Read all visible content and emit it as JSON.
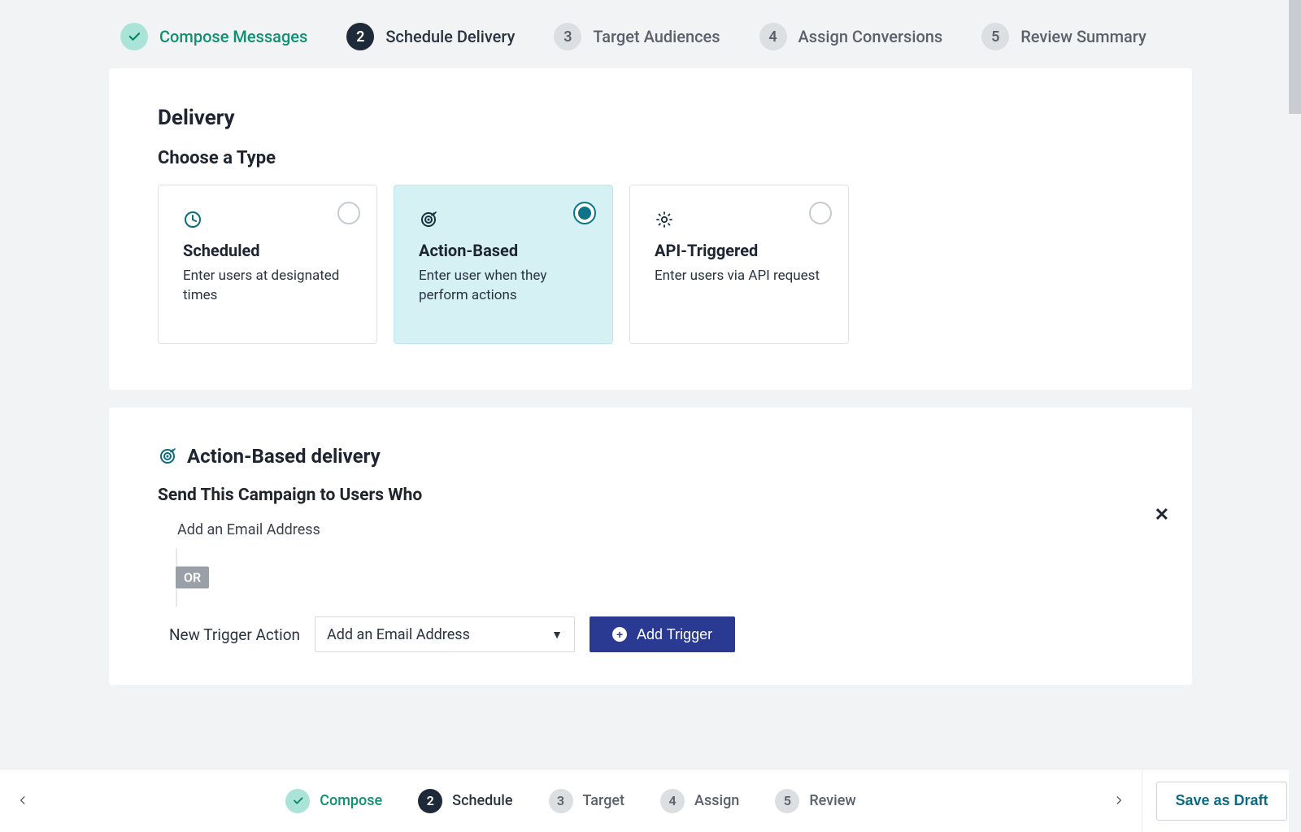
{
  "stepper": [
    {
      "state": "done",
      "label": "Compose Messages",
      "num": ""
    },
    {
      "state": "active",
      "label": "Schedule Delivery",
      "num": "2"
    },
    {
      "state": "idle",
      "label": "Target Audiences",
      "num": "3"
    },
    {
      "state": "idle",
      "label": "Assign Conversions",
      "num": "4"
    },
    {
      "state": "idle",
      "label": "Review Summary",
      "num": "5"
    }
  ],
  "delivery": {
    "title": "Delivery",
    "choose": "Choose a Type",
    "options": [
      {
        "key": "scheduled",
        "title": "Scheduled",
        "desc": "Enter users at designated times",
        "selected": false
      },
      {
        "key": "action-based",
        "title": "Action-Based",
        "desc": "Enter user when they perform actions",
        "selected": true
      },
      {
        "key": "api",
        "title": "API-Triggered",
        "desc": "Enter users via API request",
        "selected": false
      }
    ]
  },
  "action_based": {
    "title": "Action-Based delivery",
    "send_to": "Send This Campaign to Users Who",
    "existing_trigger": "Add an Email Address",
    "or": "OR",
    "new_trigger_label": "New Trigger Action",
    "select_value": "Add an Email Address",
    "add_trigger": "Add Trigger"
  },
  "bottom": {
    "steps": [
      {
        "state": "done",
        "label": "Compose",
        "num": ""
      },
      {
        "state": "active",
        "label": "Schedule",
        "num": "2"
      },
      {
        "state": "idle",
        "label": "Target",
        "num": "3"
      },
      {
        "state": "idle",
        "label": "Assign",
        "num": "4"
      },
      {
        "state": "idle",
        "label": "Review",
        "num": "5"
      }
    ],
    "save_draft": "Save as Draft"
  }
}
